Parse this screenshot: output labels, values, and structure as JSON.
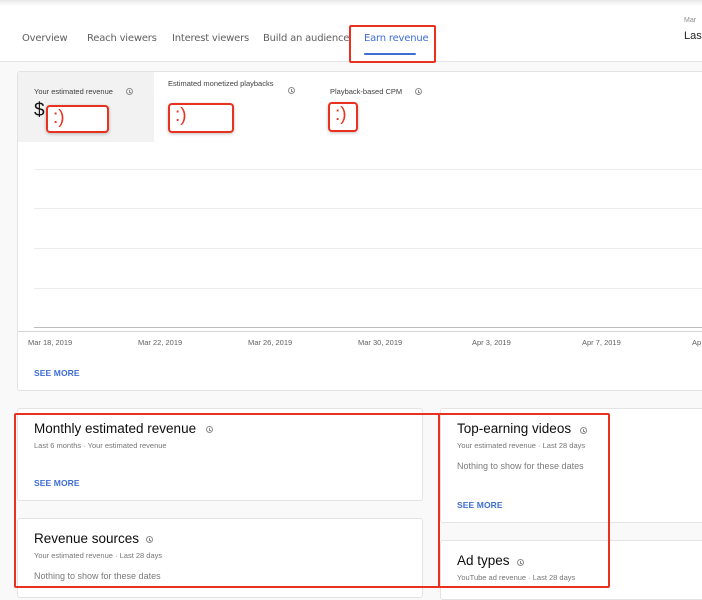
{
  "nav": {
    "tabs": [
      {
        "label": "Overview",
        "active": false
      },
      {
        "label": "Reach viewers",
        "active": false
      },
      {
        "label": "Interest viewers",
        "active": false
      },
      {
        "label": "Build an audience",
        "active": false
      },
      {
        "label": "Earn revenue",
        "active": true
      }
    ],
    "accent_color": "#3e6ed3"
  },
  "date_range": {
    "label_partial": "Mar",
    "value_partial": "Last"
  },
  "metrics": [
    {
      "label": "Your estimated revenue",
      "prefix": "$",
      "value": ":)",
      "selected": true
    },
    {
      "label": "Estimated monetized playbacks",
      "value": ":)",
      "selected": false
    },
    {
      "label": "Playback-based CPM",
      "value": ":)",
      "selected": false
    }
  ],
  "chart_data": {
    "type": "line",
    "title": "",
    "xlabel": "",
    "ylabel": "",
    "x": [
      "Mar 18, 2019",
      "Mar 22, 2019",
      "Mar 26, 2019",
      "Mar 30, 2019",
      "Apr 3, 2019",
      "Apr 7, 2019",
      "Ap"
    ],
    "series": [],
    "grid": true,
    "legend": "none"
  },
  "main_card": {
    "see_more_label": "SEE MORE"
  },
  "cards": {
    "monthly_revenue": {
      "title": "Monthly estimated revenue",
      "subtitle": "Last 6 months · Your estimated revenue",
      "see_more_label": "SEE MORE"
    },
    "revenue_sources": {
      "title": "Revenue sources",
      "subtitle": "Your estimated revenue · Last 28 days",
      "empty_text": "Nothing to show for these dates"
    },
    "top_earning_videos": {
      "title": "Top-earning videos",
      "subtitle": "Your estimated revenue · Last 28 days",
      "empty_text": "Nothing to show for these dates",
      "see_more_label": "SEE MORE"
    },
    "ad_types": {
      "title": "Ad types",
      "subtitle": "YouTube ad revenue · Last 28 days"
    }
  },
  "annotation_color": "#e8321f"
}
